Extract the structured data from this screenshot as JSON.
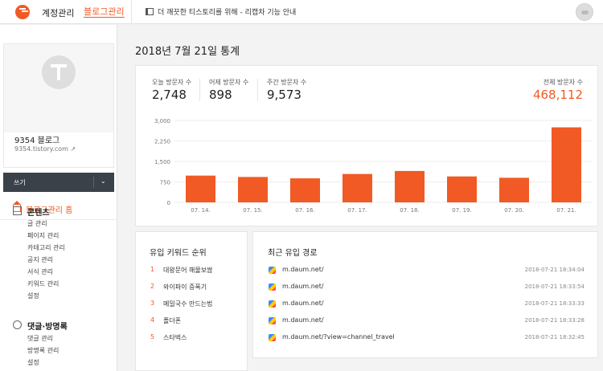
{
  "topbar": {
    "account_label": "계정관리",
    "blog_manage_label": "블로그관리",
    "notice": "더 깨끗한 티스토리를 위해 - 리캡차 기능 안내"
  },
  "sidebar": {
    "blog_name": "9354 블로그",
    "blog_url": "9354.tistory.com",
    "write_label": "쓰기",
    "home_label": "블로그관리 홈",
    "contents_title": "콘텐츠",
    "contents_items": [
      "글 관리",
      "페이지 관리",
      "카테고리 관리",
      "공지 관리",
      "서식 관리",
      "키워드 관리",
      "설정"
    ],
    "comments_title": "댓글·방명록",
    "comments_items": [
      "댓글 관리",
      "방명록 관리",
      "설정"
    ]
  },
  "main": {
    "title": "2018년 7월 21일 통계",
    "stats": {
      "today_label": "오늘 방문자 수",
      "today_value": "2,748",
      "yesterday_label": "어제 방문자 수",
      "yesterday_value": "898",
      "week_label": "주간 방문자 수",
      "week_value": "9,573",
      "total_label": "전체 방문자 수",
      "total_value": "468,112"
    },
    "keywords_title": "유입 키워드 순위",
    "keywords": [
      {
        "rank": "1",
        "text": "대왕문어 해물보쌈"
      },
      {
        "rank": "2",
        "text": "와이파이 증폭기"
      },
      {
        "rank": "3",
        "text": "메밀국수 만드는법"
      },
      {
        "rank": "4",
        "text": "폴더폰"
      },
      {
        "rank": "5",
        "text": "스타벅스"
      }
    ],
    "referrers_title": "최근 유입 경로",
    "referrers": [
      {
        "url": "m.daum.net/",
        "time": "2018-07-21 18:34:04"
      },
      {
        "url": "m.daum.net/",
        "time": "2018-07-21 18:33:54"
      },
      {
        "url": "m.daum.net/",
        "time": "2018-07-21 18:33:33"
      },
      {
        "url": "m.daum.net/",
        "time": "2018-07-21 18:33:28"
      },
      {
        "url": "m.daum.net/?view=channel_travel",
        "time": "2018-07-21 18:32:45"
      }
    ]
  },
  "colors": {
    "accent": "#f15a24",
    "dark_bar": "#3b4148"
  },
  "chart_data": {
    "type": "bar",
    "categories": [
      "07. 14.",
      "07. 15.",
      "07. 16.",
      "07. 17.",
      "07. 18.",
      "07. 19.",
      "07. 20.",
      "07. 21."
    ],
    "values": [
      980,
      930,
      880,
      1040,
      1150,
      950,
      900,
      2748
    ],
    "yticks": [
      "3,000",
      "2,250",
      "1,500",
      "750",
      "0"
    ],
    "ylim": [
      0,
      3000
    ],
    "bar_color": "#f15a24"
  }
}
